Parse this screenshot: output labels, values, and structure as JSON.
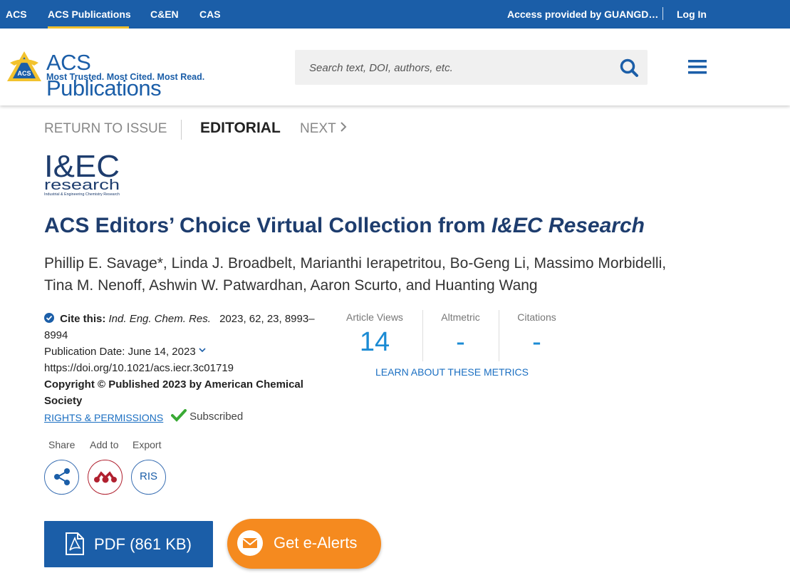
{
  "topbar": {
    "links": [
      "ACS",
      "ACS Publications",
      "C&EN",
      "CAS"
    ],
    "access": "Access provided by GUANGD…",
    "login": "Log In"
  },
  "header": {
    "logo_title": "ACS Publications",
    "logo_tagline": "Most Trusted. Most Cited. Most Read.",
    "search_placeholder": "Search text, DOI, authors, etc.",
    "icons": [
      "search-icon",
      "hamburger-menu-icon"
    ]
  },
  "nav": {
    "return": "RETURN TO ISSUE",
    "current": "EDITORIAL",
    "next": "NEXT"
  },
  "journal_logo": {
    "line1": "I&EC",
    "line2": "research",
    "line3": "Industrial & Engineering Chemistry Research"
  },
  "article": {
    "title_main": "ACS Editors’ Choice Virtual Collection from ",
    "title_italic": "I&EC Research",
    "authors_line1": "Phillip E. Savage*, Linda J. Broadbelt, Marianthi Ierapetritou, Bo-Geng Li, Massimo Morbidelli,",
    "authors_line2": "Tina M. Nenoff, Ashwin W. Patwardhan, Aaron Scurto, and Huanting Wang"
  },
  "meta": {
    "cite_label": "Cite this:",
    "cite_journal": "Ind. Eng. Chem. Res.",
    "cite_detail": "2023, 62, 23, 8993–8994",
    "pub_date_label": "Publication Date:",
    "pub_date": "June 14, 2023",
    "doi": "https://doi.org/10.1021/acs.iecr.3c01719",
    "copyright": "Copyright © Published 2023 by American Chemical Society",
    "rights": "RIGHTS & PERMISSIONS",
    "subscribed": "Subscribed"
  },
  "metrics": {
    "items": [
      {
        "label": "Article Views",
        "value": "14"
      },
      {
        "label": "Altmetric",
        "value": "-"
      },
      {
        "label": "Citations",
        "value": "-"
      }
    ],
    "learn": "LEARN ABOUT THESE METRICS",
    "accent": "#1b8bd4"
  },
  "tools": {
    "share_label": "Share",
    "add_label": "Add to",
    "export_label": "Export",
    "ris": "RIS"
  },
  "actions": {
    "pdf": "PDF (861 KB)",
    "alerts": "Get e-Alerts"
  },
  "colors": {
    "brand": "#1b5ea8",
    "alert": "#f58a1f",
    "highlight": "#f2c22e"
  }
}
